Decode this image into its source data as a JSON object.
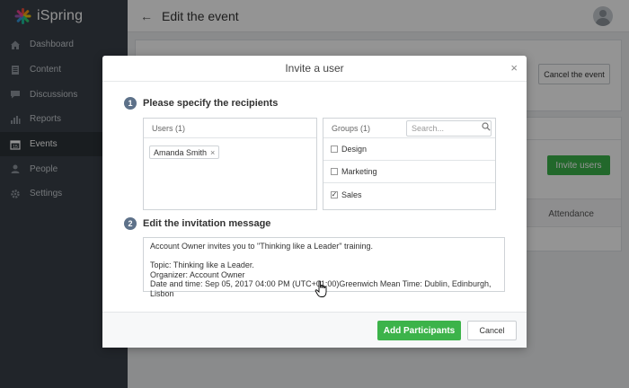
{
  "app": {
    "brand": "iSpring"
  },
  "sidebar": {
    "items": [
      {
        "label": "Dashboard",
        "icon": "home-icon"
      },
      {
        "label": "Content",
        "icon": "document-icon"
      },
      {
        "label": "Discussions",
        "icon": "chat-icon"
      },
      {
        "label": "Reports",
        "icon": "bar-chart-icon"
      },
      {
        "label": "Events",
        "icon": "calendar-icon",
        "active": true
      },
      {
        "label": "People",
        "icon": "person-icon"
      },
      {
        "label": "Settings",
        "icon": "gear-icon"
      }
    ]
  },
  "header": {
    "title": "Edit the event"
  },
  "background": {
    "cancel_event_label": "Cancel the event",
    "invite_users_label": "Invite users",
    "attendance_label": "Attendance"
  },
  "modal": {
    "title": "Invite a user",
    "step1": {
      "num": "1",
      "title": "Please specify the recipients"
    },
    "step2": {
      "num": "2",
      "title": "Edit the invitation message"
    },
    "users": {
      "header": "Users (1)",
      "selected": [
        {
          "name": "Amanda Smith",
          "remove": "×"
        }
      ]
    },
    "groups": {
      "header": "Groups (1)",
      "search_placeholder": "Search...",
      "items": [
        {
          "label": "Design",
          "checked": false
        },
        {
          "label": "Marketing",
          "checked": false
        },
        {
          "label": "Sales",
          "checked": true
        }
      ]
    },
    "message": {
      "line1": "Account Owner invites you to \"Thinking like a Leader\" training.",
      "line2": "Topic: Thinking like a Leader.",
      "line3": "Organizer: Account Owner",
      "line4": "Date and time: Sep 05, 2017 04:00 PM (UTC+01:00)Greenwich Mean Time: Dublin, Edinburgh, Lisbon"
    },
    "buttons": {
      "add": "Add Participants",
      "cancel": "Cancel"
    },
    "close_glyph": "×"
  },
  "colors": {
    "sidebar": "#3a4149",
    "accent_green": "#3cb34a",
    "step_badge": "#5d7189"
  }
}
